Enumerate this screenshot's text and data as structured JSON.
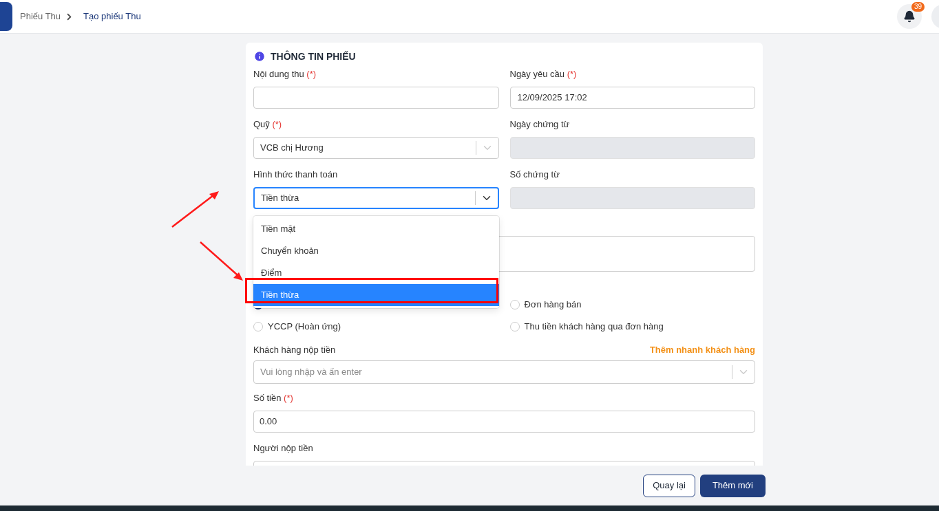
{
  "breadcrumb": [
    {
      "label": "Phiếu Thu",
      "current": false
    },
    {
      "label": "Tạo phiếu Thu",
      "current": true
    }
  ],
  "notifications": {
    "count": "39"
  },
  "section": {
    "title": "THÔNG TIN PHIẾU"
  },
  "fields_top": [
    {
      "kind": "text",
      "label": "Nội dung thu",
      "required": "(*)"
    },
    {
      "kind": "text",
      "label": "Ngày yêu cầu",
      "required": "(*)",
      "value": "12/09/2025 17:02"
    },
    {
      "kind": "select",
      "label": "Quỹ",
      "required": "(*)",
      "value": "VCB chị Hương"
    },
    {
      "kind": "text",
      "label": "Ngày chứng từ",
      "disabled": true
    },
    {
      "kind": "select",
      "label": "Hình thức thanh toán",
      "value": "Tiền thừa",
      "expanded": true,
      "options": [
        {
          "label": "Tiền mặt",
          "selected": false
        },
        {
          "label": "Chuyển khoản",
          "selected": false
        },
        {
          "label": "Điểm",
          "selected": false
        },
        {
          "label": "Tiền thừa",
          "selected": true
        }
      ]
    },
    {
      "kind": "text",
      "label": "Số chứng từ",
      "disabled": true
    }
  ],
  "radios": [
    {
      "selected": true
    },
    {
      "label": "Đơn hàng bán",
      "selected": false
    },
    {
      "label": "YCCP (Hoàn ứng)",
      "selected": false
    },
    {
      "label": "Thu tiền khách hàng qua đơn hàng",
      "selected": false
    }
  ],
  "customer": {
    "label": "Khách hàng nộp tiền",
    "link": "Thêm nhanh khách hàng",
    "placeholder": "Vui lòng nhập và ấn enter"
  },
  "amount": {
    "label": "Số tiền",
    "required": "(*)",
    "value": "0.00"
  },
  "payer": {
    "label": "Người nộp tiền"
  },
  "buttons": [
    {
      "label": "Quay lại",
      "kind": "secondary"
    },
    {
      "label": "Thêm mới",
      "kind": "primary"
    }
  ]
}
